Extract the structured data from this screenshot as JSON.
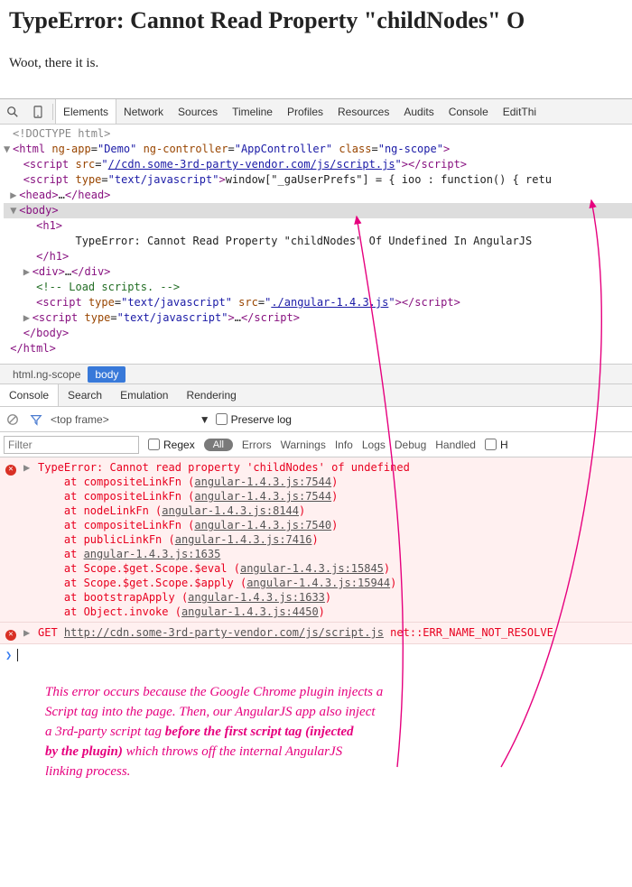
{
  "page": {
    "heading": "TypeError: Cannot Read Property \"childNodes\" O",
    "subtext": "Woot, there it is."
  },
  "toolbar": {
    "tabs": [
      "Elements",
      "Network",
      "Sources",
      "Timeline",
      "Profiles",
      "Resources",
      "Audits",
      "Console",
      "EditThi"
    ],
    "active": 0
  },
  "dom": {
    "doctype": "<!DOCTYPE html>",
    "html_open": {
      "ng_app": "Demo",
      "ng_controller": "AppController",
      "class": "ng-scope"
    },
    "script1_src": "//cdn.some-3rd-party-vendor.com/js/script.js",
    "script2_type": "text/javascript",
    "script2_text": "window[\"_gaUserPrefs\"] = { ioo : function() { retu",
    "head": "<head>…</head>",
    "body": "<body>",
    "h1_open": "<h1>",
    "h1_text": "TypeError: Cannot Read Property \"childNodes\" Of Undefined In AngularJS",
    "h1_close": "</h1>",
    "div": "<div>…</div>",
    "comment": "<!-- Load scripts. -->",
    "script3_type": "text/javascript",
    "script3_src": "./angular-1.4.3.js",
    "script4_type": "text/javascript",
    "body_close": "</body>",
    "html_close": "</html>"
  },
  "breadcrumb": {
    "root": "html.ng-scope",
    "active": "body"
  },
  "drawer": {
    "tabs": [
      "Console",
      "Search",
      "Emulation",
      "Rendering"
    ],
    "active": 0
  },
  "console_toolbar": {
    "frame": "<top frame>",
    "preserve": "Preserve log"
  },
  "filter_bar": {
    "placeholder": "Filter",
    "regex": "Regex",
    "all": "All",
    "levels": [
      "Errors",
      "Warnings",
      "Info",
      "Logs",
      "Debug",
      "Handled"
    ],
    "hide_cb": "H"
  },
  "console": {
    "error_head": "TypeError: Cannot read property 'childNodes' of undefined",
    "stack": [
      {
        "fn": "compositeLinkFn",
        "loc": "angular-1.4.3.js:7544"
      },
      {
        "fn": "compositeLinkFn",
        "loc": "angular-1.4.3.js:7544"
      },
      {
        "fn": "nodeLinkFn",
        "loc": "angular-1.4.3.js:8144"
      },
      {
        "fn": "compositeLinkFn",
        "loc": "angular-1.4.3.js:7540"
      },
      {
        "fn": "publicLinkFn",
        "loc": "angular-1.4.3.js:7416"
      },
      {
        "fn": "",
        "loc": "angular-1.4.3.js:1635"
      },
      {
        "fn": "Scope.$get.Scope.$eval",
        "loc": "angular-1.4.3.js:15845"
      },
      {
        "fn": "Scope.$get.Scope.$apply",
        "loc": "angular-1.4.3.js:15944"
      },
      {
        "fn": "bootstrapApply",
        "loc": "angular-1.4.3.js:1633"
      },
      {
        "fn": "Object.invoke",
        "loc": "angular-1.4.3.js:4450"
      }
    ],
    "net_error": {
      "method": "GET",
      "url": "http://cdn.some-3rd-party-vendor.com/js/script.js",
      "status": "net::ERR_NAME_NOT_RESOLVE"
    }
  },
  "annotation": {
    "l1": "This error occurs because the Google Chrome plugin injects a",
    "l2": "Script tag into the page. Then, our AngularJS app also inject",
    "l3_a": "a 3rd-party script tag ",
    "l3_b": "before the first script tag (injected",
    "l4_a": "by the plugin)",
    "l4_b": " which throws off the internal AngularJS",
    "l5": "linking process."
  }
}
